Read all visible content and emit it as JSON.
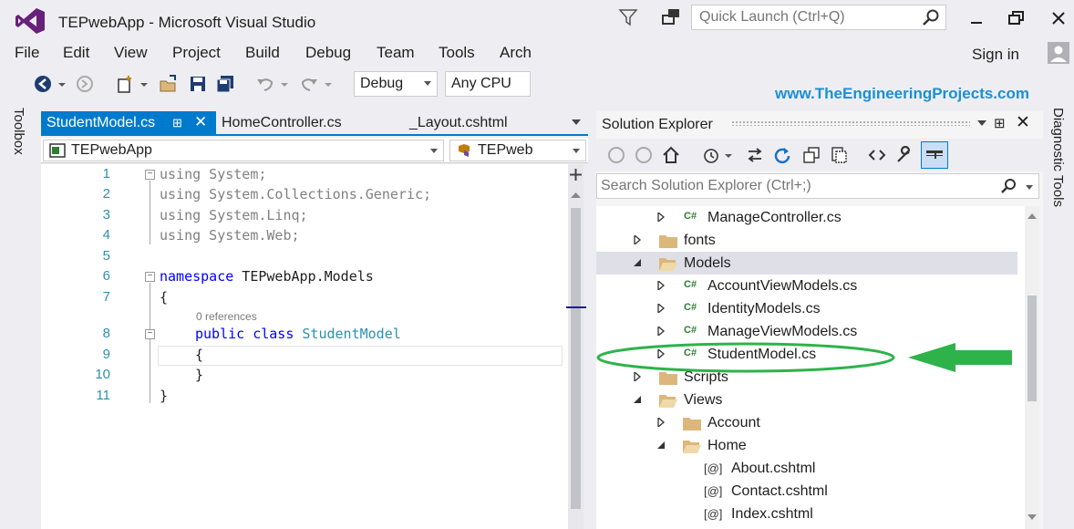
{
  "window": {
    "title": "TEPwebApp - Microsoft Visual Studio",
    "quick_launch_placeholder": "Quick Launch (Ctrl+Q)"
  },
  "menu": [
    "File",
    "Edit",
    "View",
    "Project",
    "Build",
    "Debug",
    "Team",
    "Tools",
    "Arch"
  ],
  "account": {
    "sign_in": "Sign in"
  },
  "toolbar": {
    "configuration": "Debug",
    "platform": "Any CPU"
  },
  "watermark": "www.TheEngineeringProjects.com",
  "side_tabs": {
    "toolbox": "Toolbox",
    "diagnostic": "Diagnostic Tools"
  },
  "editor": {
    "tabs": [
      {
        "label": "StudentModel.cs",
        "active": true
      },
      {
        "label": "HomeController.cs",
        "active": false
      },
      {
        "label": "_Layout.cshtml",
        "active": false
      }
    ],
    "nav_project": "TEPwebApp",
    "nav_type": "TEPweb",
    "references_hint": "0 references",
    "line_numbers": [
      "1",
      "2",
      "3",
      "4",
      "5",
      "6",
      "7",
      "8",
      "9",
      "10",
      "11"
    ],
    "code": {
      "l1_kw": "using",
      "l1_rest": " System;",
      "l2_kw": "using",
      "l2_rest": " System.Collections.Generic;",
      "l3_kw": "using",
      "l3_rest": " System.Linq;",
      "l4_kw": "using",
      "l4_rest": " System.Web;",
      "l6_kw": "namespace",
      "l6_rest": " TEPwebApp.Models",
      "l7": "{",
      "l8_kw1": "public",
      "l8_kw2": "class",
      "l8_cls": "StudentModel",
      "l9": "{",
      "l10": "}",
      "l11": "}"
    }
  },
  "solution_explorer": {
    "title": "Solution Explorer",
    "search_placeholder": "Search Solution Explorer (Ctrl+;)",
    "items": [
      {
        "label": "ManageController.cs",
        "type": "cs"
      },
      {
        "label": "fonts",
        "type": "folder"
      },
      {
        "label": "Models",
        "type": "folder-open"
      },
      {
        "label": "AccountViewModels.cs",
        "type": "cs"
      },
      {
        "label": "IdentityModels.cs",
        "type": "cs"
      },
      {
        "label": "ManageViewModels.cs",
        "type": "cs"
      },
      {
        "label": "StudentModel.cs",
        "type": "cs"
      },
      {
        "label": "Scripts",
        "type": "folder"
      },
      {
        "label": "Views",
        "type": "folder-open"
      },
      {
        "label": "Account",
        "type": "folder"
      },
      {
        "label": "Home",
        "type": "folder-open"
      },
      {
        "label": "About.cshtml",
        "type": "cshtml"
      },
      {
        "label": "Contact.cshtml",
        "type": "cshtml"
      },
      {
        "label": "Index.cshtml",
        "type": "cshtml"
      }
    ],
    "cs_badge": "C#",
    "razor_badge": "[@]"
  },
  "colors": {
    "accent": "#007acc",
    "annotation": "#2db34a",
    "watermark": "#1b8fd6"
  }
}
